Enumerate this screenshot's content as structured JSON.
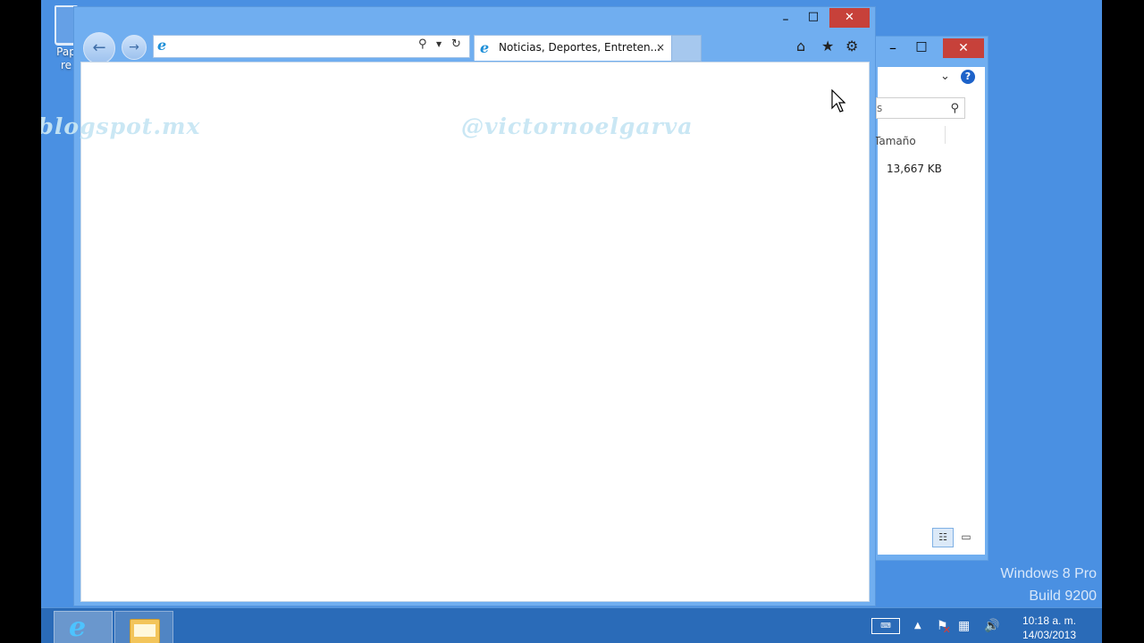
{
  "desktop": {
    "icon_label_line1": "Pap",
    "icon_label_line2": "re",
    "watermark_left": "va.blogspot.mx",
    "watermark_right": "@victornoelgarva",
    "os_name": "Windows 8 Pro",
    "os_build": "Build 9200"
  },
  "browser": {
    "address_value": "",
    "tab_title": "Noticias, Deportes, Entreten...",
    "tab_close": "×",
    "min_glyph": "–",
    "max_glyph": "□",
    "close_glyph": "✕",
    "back_glyph": "←",
    "forward_glyph": "→",
    "search_glyph": "⚲",
    "dropdown_glyph": "▼",
    "refresh_glyph": "↻",
    "home_glyph": "⌂",
    "favorites_glyph": "★",
    "settings_glyph": "⚙",
    "logo_glyph": "e"
  },
  "explorer": {
    "search_value": "s",
    "search_glyph": "⚲",
    "chevron_glyph": "⌄",
    "help_glyph": "?",
    "column_header": "Tamaño",
    "file_size": "13,667 KB",
    "min_glyph": "–",
    "max_glyph": "□",
    "close_glyph": "✕",
    "view_details_glyph": "☷",
    "view_large_glyph": "▭"
  },
  "taskbar": {
    "keyboard_glyph": "⌨",
    "tray_up_glyph": "▲",
    "flag_glyph": "⚑",
    "flag_x": "✕",
    "network_glyph": "▦",
    "volume_glyph": "🔊",
    "time": "10:18 a. m.",
    "date": "14/03/2013"
  },
  "colors": {
    "desktop_bg": "#4a90e2",
    "window_frame": "#70aef0",
    "close_red": "#c7413a",
    "taskbar": "#2a6bb8"
  }
}
